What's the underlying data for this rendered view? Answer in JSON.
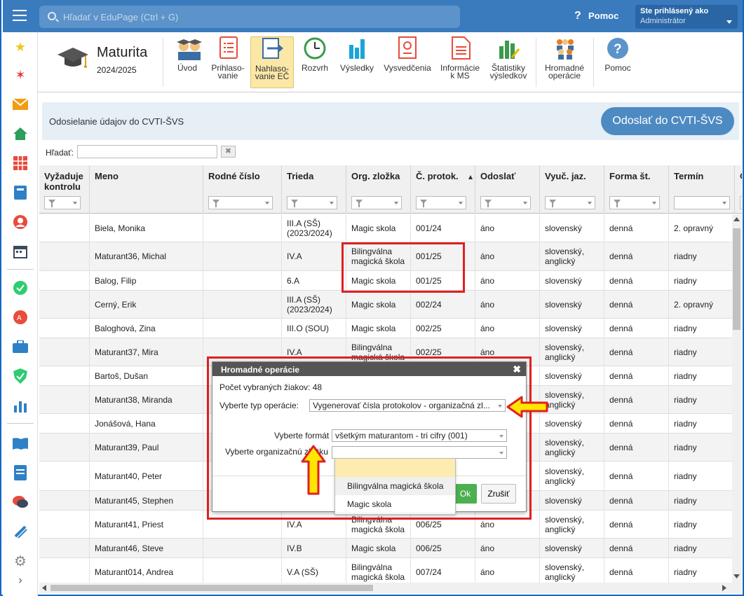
{
  "topbar": {
    "search_placeholder": "Hľadať v EduPage (Ctrl + G)",
    "help_label": "Pomoc",
    "user_line1": "Ste prihlásený ako",
    "user_line2": "Administrátor"
  },
  "module": {
    "title": "Maturita",
    "year": "2024/2025",
    "tools": [
      {
        "label1": "Úvod",
        "label2": "",
        "icon": "teachers-icon"
      },
      {
        "label1": "Prihlaso-",
        "label2": "vanie",
        "icon": "form-icon"
      },
      {
        "label1": "Nahlaso-",
        "label2": "vanie EČ",
        "icon": "export-icon"
      },
      {
        "label1": "Rozvrh",
        "label2": "",
        "icon": "clock-icon"
      },
      {
        "label1": "Výsledky",
        "label2": "",
        "icon": "bar-chart-icon"
      },
      {
        "label1": "Vysvedčenia",
        "label2": "",
        "icon": "certificate-icon"
      },
      {
        "label1": "Informácie",
        "label2": "k MS",
        "icon": "document-icon"
      },
      {
        "label1": "Štatistiky",
        "label2": "výsledkov",
        "icon": "stats-icon"
      },
      {
        "label1": "Hromadné",
        "label2": "operácie",
        "icon": "group-icon"
      },
      {
        "label1": "Pomoc",
        "label2": "",
        "icon": "help-icon"
      }
    ]
  },
  "infobar": {
    "text": "Odosielanie údajov do CVTI-ŠVS",
    "send_button": "Odoslať do CVTI-ŠVS"
  },
  "filter": {
    "label": "Hľadať:",
    "clear": "✖"
  },
  "table": {
    "columns": [
      {
        "l1": "Vyžaduje",
        "l2": "kontrolu"
      },
      {
        "l1": "Meno",
        "l2": ""
      },
      {
        "l1": "Rodné číslo",
        "l2": ""
      },
      {
        "l1": "Trieda",
        "l2": ""
      },
      {
        "l1": "Org. zložka",
        "l2": ""
      },
      {
        "l1": "Č. protok.",
        "l2": ""
      },
      {
        "l1": "Odoslať",
        "l2": ""
      },
      {
        "l1": "Vyuč. jaz.",
        "l2": ""
      },
      {
        "l1": "Forma št.",
        "l2": ""
      },
      {
        "l1": "Termín",
        "l2": ""
      },
      {
        "l1": "O",
        "l2": ""
      }
    ],
    "rows": [
      {
        "meno": "Biela, Monika",
        "trieda1": "III.A (SŠ)",
        "trieda2": "(2023/2024)",
        "org1": "Magic skola",
        "org2": "",
        "prot": "001/24",
        "odos": "áno",
        "jaz1": "slovenský",
        "jaz2": "",
        "forma": "denná",
        "termin": "2. opravný"
      },
      {
        "meno": "Maturant36, Michal",
        "trieda1": "IV.A",
        "trieda2": "",
        "org1": "Bilingválna",
        "org2": "magická škola",
        "prot": "001/25",
        "odos": "áno",
        "jaz1": "slovenský,",
        "jaz2": "anglický",
        "forma": "denná",
        "termin": "riadny"
      },
      {
        "meno": "Balog, Filip",
        "trieda1": "6.A",
        "trieda2": "",
        "org1": "Magic skola",
        "org2": "",
        "prot": "001/25",
        "odos": "áno",
        "jaz1": "slovenský",
        "jaz2": "",
        "forma": "denná",
        "termin": "riadny"
      },
      {
        "meno": "Cerný, Erik",
        "trieda1": "III.A (SŠ)",
        "trieda2": "(2023/2024)",
        "org1": "Magic skola",
        "org2": "",
        "prot": "002/24",
        "odos": "áno",
        "jaz1": "slovenský",
        "jaz2": "",
        "forma": "denná",
        "termin": "2. opravný"
      },
      {
        "meno": "Baloghová, Zina",
        "trieda1": "III.O (SOU)",
        "trieda2": "",
        "org1": "Magic skola",
        "org2": "",
        "prot": "002/25",
        "odos": "áno",
        "jaz1": "slovenský",
        "jaz2": "",
        "forma": "denná",
        "termin": "riadny"
      },
      {
        "meno": "Maturant37, Mira",
        "trieda1": "IV.A",
        "trieda2": "",
        "org1": "Bilingválna",
        "org2": "magická škola",
        "prot": "002/25",
        "odos": "áno",
        "jaz1": "slovenský,",
        "jaz2": "anglický",
        "forma": "denná",
        "termin": "riadny"
      },
      {
        "meno": "Bartoš, Dušan",
        "trieda1": "",
        "trieda2": "",
        "org1": "",
        "org2": "",
        "prot": "",
        "odos": "",
        "jaz1": "slovenský",
        "jaz2": "",
        "forma": "denná",
        "termin": "riadny"
      },
      {
        "meno": "Maturant38, Miranda",
        "trieda1": "",
        "trieda2": "",
        "org1": "",
        "org2": "",
        "prot": "",
        "odos": "",
        "jaz1": "slovenský,",
        "jaz2": "anglický",
        "forma": "denná",
        "termin": "riadny"
      },
      {
        "meno": "Jonášová, Hana",
        "trieda1": "",
        "trieda2": "",
        "org1": "",
        "org2": "",
        "prot": "",
        "odos": "",
        "jaz1": "slovenský",
        "jaz2": "",
        "forma": "denná",
        "termin": "riadny"
      },
      {
        "meno": "Maturant39, Paul",
        "trieda1": "",
        "trieda2": "",
        "org1": "",
        "org2": "",
        "prot": "",
        "odos": "",
        "jaz1": "slovenský,",
        "jaz2": "anglický",
        "forma": "denná",
        "termin": "riadny"
      },
      {
        "meno": "Maturant40, Peter",
        "trieda1": "",
        "trieda2": "",
        "org1": "",
        "org2": "",
        "prot": "",
        "odos": "",
        "jaz1": "slovenský,",
        "jaz2": "anglický",
        "forma": "denná",
        "termin": "riadny"
      },
      {
        "meno": "Maturant45, Stephen",
        "trieda1": "",
        "trieda2": "",
        "org1": "",
        "org2": "",
        "prot": "",
        "odos": "",
        "jaz1": "slovenský",
        "jaz2": "",
        "forma": "denná",
        "termin": "riadny"
      },
      {
        "meno": "Maturant41, Priest",
        "trieda1": "IV.A",
        "trieda2": "",
        "org1": "Bilingválna",
        "org2": "magická škola",
        "prot": "006/25",
        "odos": "áno",
        "jaz1": "slovenský,",
        "jaz2": "anglický",
        "forma": "denná",
        "termin": "riadny"
      },
      {
        "meno": "Maturant46, Steve",
        "trieda1": "IV.B",
        "trieda2": "",
        "org1": "Magic skola",
        "org2": "",
        "prot": "006/25",
        "odos": "áno",
        "jaz1": "slovenský",
        "jaz2": "",
        "forma": "denná",
        "termin": "riadny"
      },
      {
        "meno": "Maturant014, Andrea",
        "trieda1": "V.A (SŠ)",
        "trieda2": "",
        "org1": "Bilingválna",
        "org2": "magická škola",
        "prot": "007/24",
        "odos": "áno",
        "jaz1": "slovenský,",
        "jaz2": "anglický",
        "forma": "denná",
        "termin": "riadny"
      }
    ]
  },
  "modal": {
    "title": "Hromadné operácie",
    "close": "✖",
    "count_text": "Počet vybraných žiakov: 48",
    "op_label": "Vyberte typ operácie:",
    "op_value": "Vygenerovať čísla protokolov - organizačná zl...",
    "format_label": "Vyberte formát",
    "format_value": "všetkým maturantom - tri cifry (001)",
    "org_label": "Vyberte organizačnú zložku",
    "org_value": "",
    "ok": "Ok",
    "cancel": "Zrušiť"
  },
  "dropdown": {
    "options": [
      "Bilingválna magická škola",
      "Magic skola"
    ]
  },
  "colors": {
    "topbar": "#3a7bbd",
    "highlight_red": "#e02020",
    "arrow_yellow": "#ffe600",
    "ok_green": "#4caf50"
  }
}
